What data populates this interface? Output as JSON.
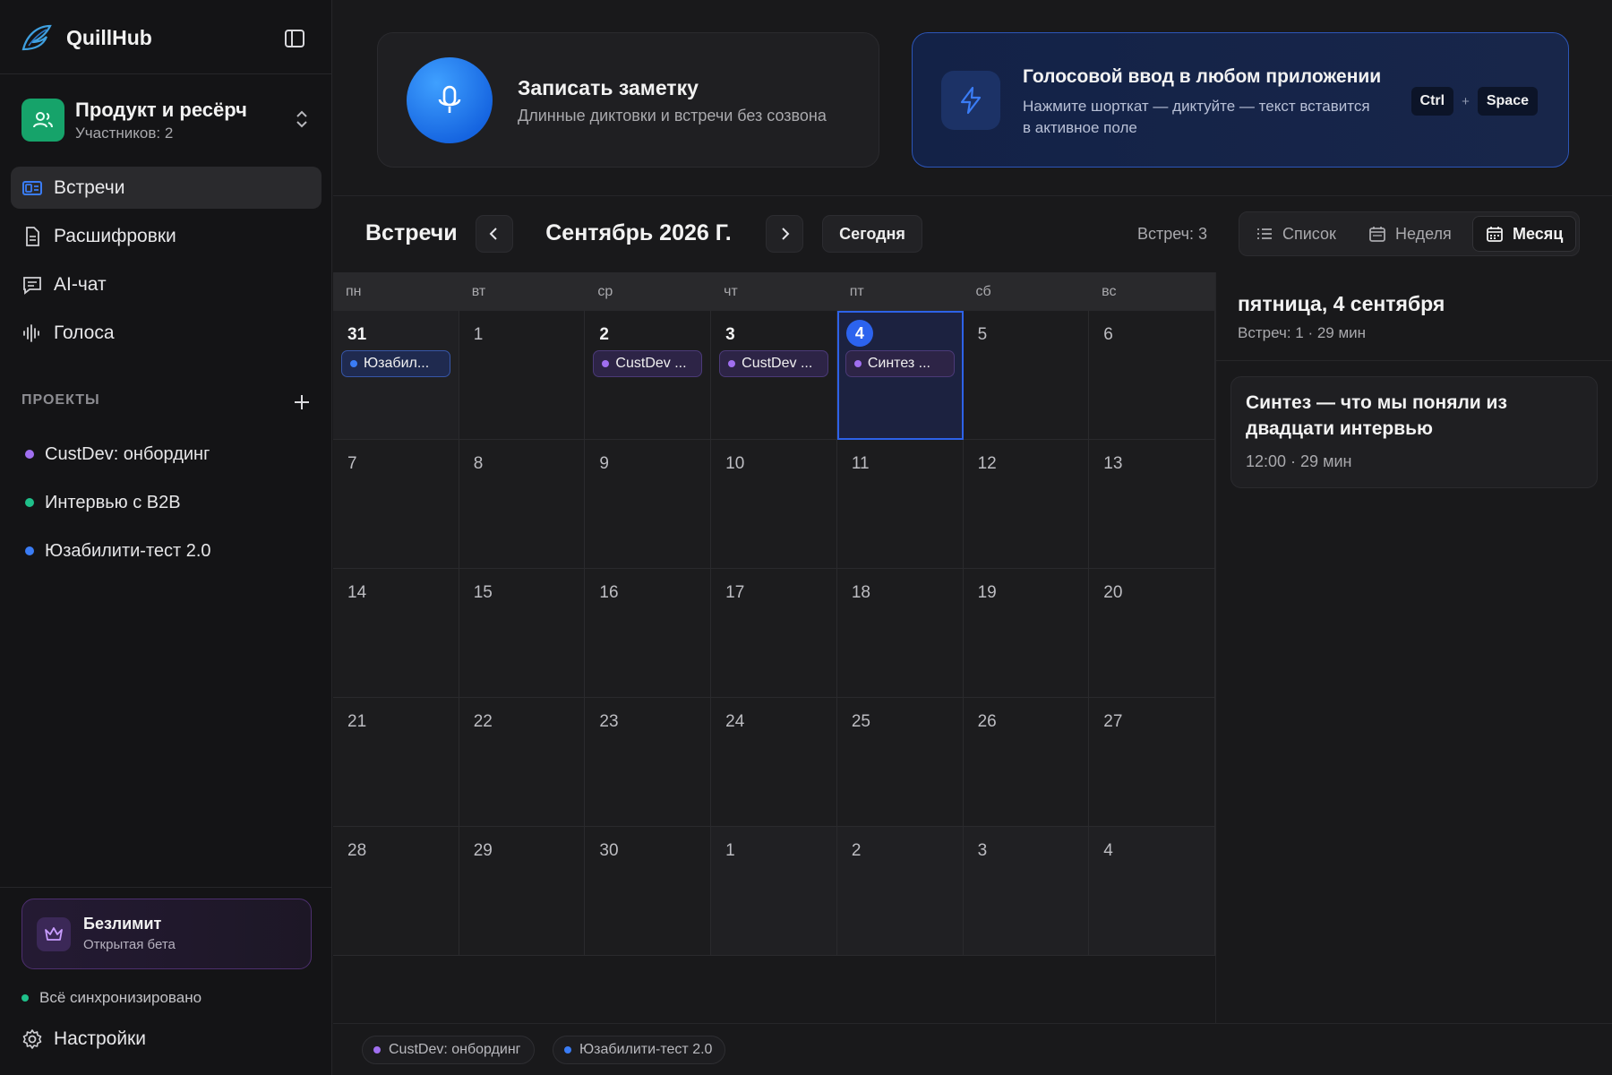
{
  "app": {
    "name": "QuillHub"
  },
  "workspace": {
    "name": "Продукт и ресёрч",
    "members": "Участников: 2"
  },
  "nav": [
    {
      "label": "Встречи",
      "icon": "meetings-icon",
      "active": true
    },
    {
      "label": "Расшифровки",
      "icon": "document-icon",
      "active": false
    },
    {
      "label": "AI-чат",
      "icon": "chat-icon",
      "active": false
    },
    {
      "label": "Голоса",
      "icon": "waveform-icon",
      "active": false
    }
  ],
  "projects": {
    "heading": "ПРОЕКТЫ",
    "items": [
      {
        "label": "CustDev: онбординг",
        "color": "#a06ff0"
      },
      {
        "label": "Интервью с B2B",
        "color": "#1fc08a"
      },
      {
        "label": "Юзабилити-тест 2.0",
        "color": "#3a7cf5"
      }
    ]
  },
  "plan": {
    "title": "Безлимит",
    "subtitle": "Открытая бета"
  },
  "sync_status": "Всё синхронизировано",
  "settings_label": "Настройки",
  "record_card": {
    "title": "Записать заметку",
    "subtitle": "Длинные диктовки и встречи без созвона"
  },
  "voice_card": {
    "title": "Голосовой ввод в любом приложении",
    "subtitle": "Нажмите шорткат — диктуйте — текст вставится в активное поле",
    "key1": "Ctrl",
    "plus": "+",
    "key2": "Space"
  },
  "toolbar": {
    "title": "Встречи",
    "month": "Сентябрь 2026 Г.",
    "today": "Сегодня",
    "count": "Встреч: 3",
    "views": [
      {
        "label": "Список",
        "icon": "list-icon",
        "active": false
      },
      {
        "label": "Неделя",
        "icon": "calendar-week-icon",
        "active": false
      },
      {
        "label": "Месяц",
        "icon": "calendar-month-icon",
        "active": true
      }
    ]
  },
  "calendar": {
    "weekdays": [
      "пн",
      "вт",
      "ср",
      "чт",
      "пт",
      "сб",
      "вс"
    ],
    "days": [
      {
        "n": "31",
        "out": true,
        "event": {
          "label": "Юзабил...",
          "color": "blue"
        }
      },
      {
        "n": "1"
      },
      {
        "n": "2",
        "event": {
          "label": "CustDev ...",
          "color": "purple"
        }
      },
      {
        "n": "3",
        "event": {
          "label": "CustDev ...",
          "color": "purple"
        }
      },
      {
        "n": "4",
        "selected": true,
        "event": {
          "label": "Синтез ...",
          "color": "purple"
        }
      },
      {
        "n": "5"
      },
      {
        "n": "6"
      },
      {
        "n": "7"
      },
      {
        "n": "8"
      },
      {
        "n": "9"
      },
      {
        "n": "10"
      },
      {
        "n": "11"
      },
      {
        "n": "12"
      },
      {
        "n": "13"
      },
      {
        "n": "14"
      },
      {
        "n": "15"
      },
      {
        "n": "16"
      },
      {
        "n": "17"
      },
      {
        "n": "18"
      },
      {
        "n": "19"
      },
      {
        "n": "20"
      },
      {
        "n": "21"
      },
      {
        "n": "22"
      },
      {
        "n": "23"
      },
      {
        "n": "24"
      },
      {
        "n": "25"
      },
      {
        "n": "26"
      },
      {
        "n": "27"
      },
      {
        "n": "28"
      },
      {
        "n": "29"
      },
      {
        "n": "30"
      },
      {
        "n": "1",
        "out": true
      },
      {
        "n": "2",
        "out": true
      },
      {
        "n": "3",
        "out": true
      },
      {
        "n": "4",
        "out": true
      }
    ]
  },
  "day_panel": {
    "date": "пятница, 4 сентября",
    "meta": "Встреч: 1 · 29 мин",
    "event": {
      "title": "Синтез — что мы поняли из двадцати интервью",
      "time": "12:00  ·  29 мин"
    }
  },
  "legend": [
    {
      "label": "CustDev: онбординг",
      "color": "#a06ff0"
    },
    {
      "label": "Юзабилити-тест 2.0",
      "color": "#3a7cf5"
    }
  ],
  "colors": {
    "accent": "#2c63ee",
    "purple": "#a06ff0",
    "blue": "#3a7cf5",
    "green": "#1fc08a"
  }
}
